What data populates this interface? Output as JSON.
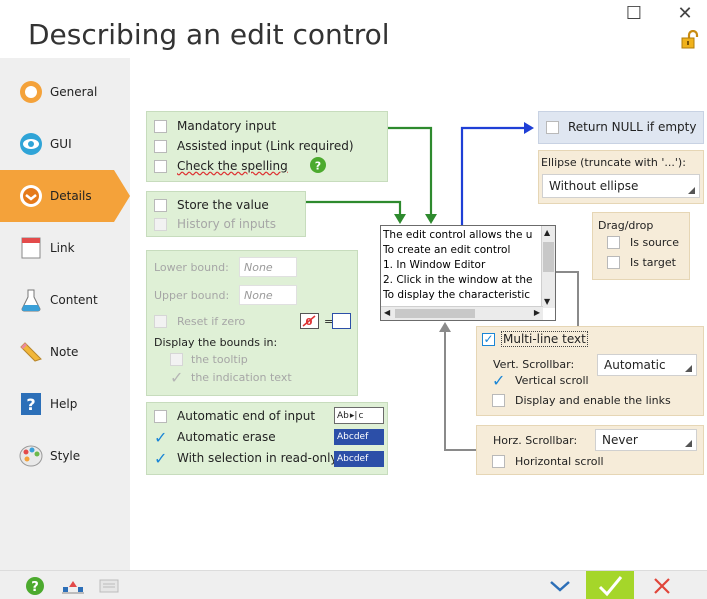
{
  "window": {
    "title": "Describing an edit control",
    "minimize_glyph": "☐",
    "close_glyph": "✕"
  },
  "sidebar": {
    "items": [
      {
        "label": "General",
        "icon": "general-icon"
      },
      {
        "label": "GUI",
        "icon": "gui-eye-icon"
      },
      {
        "label": "Details",
        "icon": "details-icon",
        "active": true
      },
      {
        "label": "Link",
        "icon": "link-icon"
      },
      {
        "label": "Content",
        "icon": "content-flask-icon"
      },
      {
        "label": "Note",
        "icon": "note-pencil-icon"
      },
      {
        "label": "Help",
        "icon": "help-icon"
      },
      {
        "label": "Style",
        "icon": "style-palette-icon"
      }
    ]
  },
  "input_options": {
    "mandatory": "Mandatory input",
    "assisted": "Assisted input (Link required)",
    "spelling": "Check the spelling"
  },
  "store_value": {
    "store": "Store the value",
    "history": "History of inputs"
  },
  "bounds": {
    "lower_label": "Lower bound:",
    "lower_placeholder": "None",
    "upper_label": "Upper bound:",
    "upper_placeholder": "None",
    "reset_zero": "Reset if zero",
    "display_label": "Display the bounds in:",
    "tooltip": "the tooltip",
    "indication": "the indication text"
  },
  "auto_options": {
    "end_of_input": "Automatic end of input",
    "erase": "Automatic erase",
    "selection_readonly": "With selection in read-only",
    "sample_end": "Ab",
    "sample_end_2": "c",
    "sample_erase": "Abcdef",
    "sample_select": "Abcdef"
  },
  "return_null": {
    "label": "Return NULL if empty",
    "checked": false
  },
  "ellipse": {
    "label": "Ellipse (truncate with '...'):",
    "value": "Without ellipse"
  },
  "dragdrop": {
    "title": "Drag/drop",
    "source": "Is source",
    "target": "Is target"
  },
  "edit_preview": {
    "lines": [
      "The edit control allows the u",
      "To create an edit control",
      "1. In Window Editor",
      "2. Click in the window at the",
      "To display the characteristic"
    ]
  },
  "multiline": {
    "label": "Multi-line text",
    "checked": true,
    "vert_label": "Vert. Scrollbar:",
    "vert_value": "Automatic",
    "vert_scroll": "Vertical scroll",
    "vert_scroll_checked": true,
    "links": "Display and enable the links",
    "horz_label": "Horz. Scrollbar:",
    "horz_value": "Never",
    "horz_scroll": "Horizontal scroll"
  },
  "colors": {
    "accent_orange": "#f4a23a",
    "green_box": "#dff0d6",
    "tan_box": "#f6ecd9",
    "blue_box": "#dfe6f1",
    "ok_green": "#a5d62a",
    "cancel_red": "#e0453a",
    "check_blue": "#1b86d6"
  }
}
